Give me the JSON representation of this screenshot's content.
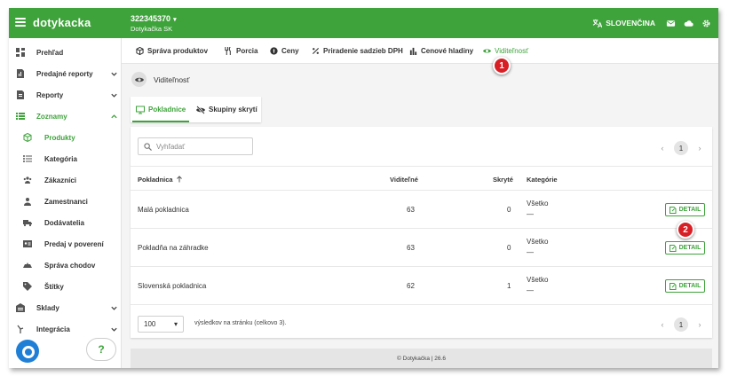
{
  "header": {
    "logo": "dotykacka",
    "account_id": "322345370",
    "account_name": "Dotykačka SK",
    "language": "SLOVENČINA"
  },
  "sidebar": {
    "items": [
      {
        "label": "Prehľad",
        "icon": "dashboard-icon",
        "expandable": false,
        "active": false
      },
      {
        "label": "Predajné reporty",
        "icon": "report-icon",
        "expandable": true,
        "active": false
      },
      {
        "label": "Reporty",
        "icon": "document-icon",
        "expandable": true,
        "active": false
      },
      {
        "label": "Zoznamy",
        "icon": "list-icon",
        "expandable": true,
        "active": true
      },
      {
        "label": "Produkty",
        "icon": "cube-icon",
        "sub": true,
        "active": true
      },
      {
        "label": "Kategória",
        "icon": "category-icon",
        "sub": true
      },
      {
        "label": "Zákazníci",
        "icon": "customers-icon",
        "sub": true
      },
      {
        "label": "Zamestnanci",
        "icon": "person-icon",
        "sub": true
      },
      {
        "label": "Dodávatelia",
        "icon": "truck-icon",
        "sub": true
      },
      {
        "label": "Predaj v poverení",
        "icon": "id-card-icon",
        "sub": true
      },
      {
        "label": "Správa chodov",
        "icon": "course-icon",
        "sub": true
      },
      {
        "label": "Štítky",
        "icon": "tag-icon",
        "sub": true
      },
      {
        "label": "Sklady",
        "icon": "warehouse-icon",
        "expandable": true
      },
      {
        "label": "Integrácia",
        "icon": "integration-icon",
        "expandable": true
      }
    ],
    "help": "?"
  },
  "tabs": [
    {
      "label": "Správa produktov",
      "icon": "cube-icon"
    },
    {
      "label": "Porcia",
      "icon": "cutlery-icon"
    },
    {
      "label": "Ceny",
      "icon": "price-icon"
    },
    {
      "label": "Priradenie sadzieb DPH",
      "icon": "percent-icon"
    },
    {
      "label": "Cenové hladiny",
      "icon": "bar-chart-icon"
    },
    {
      "label": "Viditeľnosť",
      "icon": "eye-icon",
      "active": true
    }
  ],
  "section": {
    "title": "Viditeľnosť"
  },
  "subtabs": [
    {
      "label": "Pokladnice",
      "icon": "monitor-icon",
      "active": true
    },
    {
      "label": "Skupiny skrytí",
      "icon": "eye-off-icon"
    }
  ],
  "search": {
    "placeholder": "Vyhľadať"
  },
  "pager": {
    "page": "1",
    "prev": "‹",
    "next": "›"
  },
  "table": {
    "columns": [
      "Pokladnica",
      "Viditeľné",
      "Skryté",
      "Kategórie"
    ],
    "rows": [
      {
        "name": "Malá pokladnica",
        "visible": "63",
        "hidden": "0",
        "category": "Všetko",
        "category_sub": "—",
        "action": "DETAIL"
      },
      {
        "name": "Pokladňa na záhradke",
        "visible": "63",
        "hidden": "0",
        "category": "Všetko",
        "category_sub": "—",
        "action": "DETAIL"
      },
      {
        "name": "Slovenská pokladnica",
        "visible": "62",
        "hidden": "1",
        "category": "Všetko",
        "category_sub": "—",
        "action": "DETAIL"
      }
    ]
  },
  "footer_bar": {
    "per_page": "100",
    "per_page_text": "výsledkov na stránku (celkovo 3)."
  },
  "page_footer": "© Dotykačka  | 26.6",
  "annotations": [
    "1",
    "2"
  ],
  "colors": {
    "brand": "#3ea33b",
    "badge": "#d81f26"
  }
}
